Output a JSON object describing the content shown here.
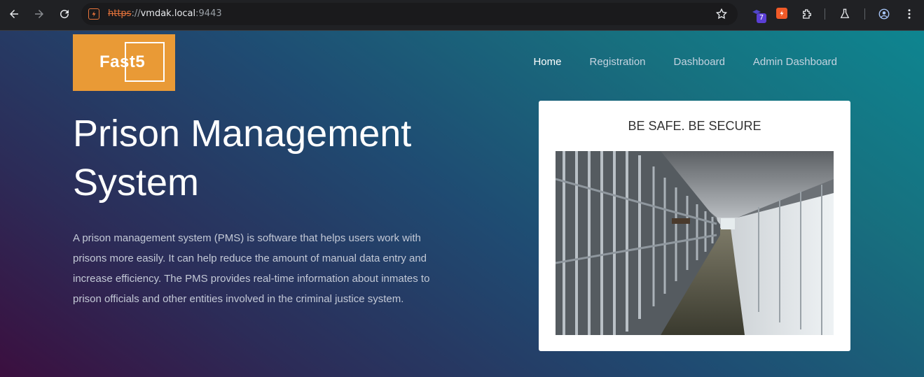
{
  "browser": {
    "url_scheme": "https",
    "url_separator": "://",
    "url_host": "vmdak.local",
    "url_port": ":9443",
    "extension_badge": "7",
    "icons": [
      "back-icon",
      "forward-icon",
      "reload-icon",
      "site-info-icon",
      "bookmark-star-icon",
      "extensions-icon",
      "labs-icon",
      "profile-icon",
      "menu-icon"
    ]
  },
  "site": {
    "logo_text": "Fast5",
    "nav": [
      {
        "label": "Home",
        "active": true
      },
      {
        "label": "Registration",
        "active": false
      },
      {
        "label": "Dashboard",
        "active": false
      },
      {
        "label": "Admin Dashboard",
        "active": false
      }
    ]
  },
  "hero": {
    "title": "Prison Management System",
    "description": "A prison management system (PMS) is software that helps users work with prisons more easily. It can help reduce the amount of manual data entry and increase efficiency. The PMS provides real-time information about inmates to prison officials and other entities involved in the criminal justice system."
  },
  "card": {
    "title": "BE SAFE. BE SECURE"
  },
  "colors": {
    "logo_bg": "#e99a36",
    "accent_orange": "#e8743b",
    "nav_active": "#ffffff",
    "nav_inactive": "#c5d3e0"
  }
}
